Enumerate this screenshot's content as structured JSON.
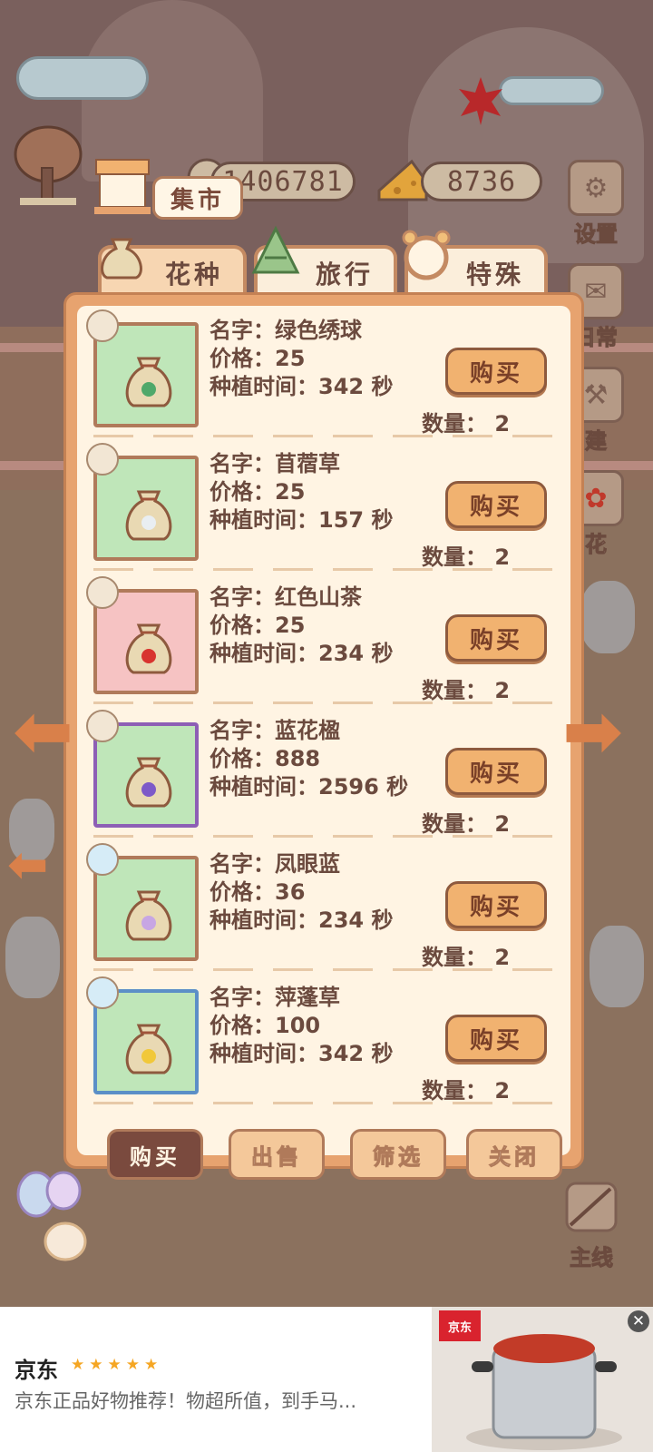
{
  "currency": {
    "coins": "1406781",
    "cheese": "8736"
  },
  "market_sign": "集市",
  "side_buttons": [
    {
      "label": "设置",
      "icon": "gear-icon"
    },
    {
      "label": "日常",
      "icon": "scroll-icon"
    },
    {
      "label": "建",
      "icon": "hammer-icon"
    },
    {
      "label": "花",
      "icon": "flower-icon"
    }
  ],
  "tabs": [
    {
      "label": "花种",
      "icon": "seed-bag-icon",
      "active": true
    },
    {
      "label": "旅行",
      "icon": "dumpling-icon",
      "active": false
    },
    {
      "label": "特殊",
      "icon": "frame-icon",
      "active": false
    }
  ],
  "item_labels": {
    "name": "名字：",
    "price": "价格：",
    "time": "种植时间：",
    "unit": "秒",
    "qty": "数量：",
    "buy": "购买"
  },
  "items": [
    {
      "name": "绿色绣球",
      "price": "25",
      "time": "342",
      "qty": "2",
      "bg": "#bfe6b9",
      "border": "#b07a5a",
      "flower": "#4fa86a",
      "season": "autumn"
    },
    {
      "name": "苜蓿草",
      "price": "25",
      "time": "157",
      "qty": "2",
      "bg": "#bfe6b9",
      "border": "#b07a5a",
      "flower": "#e9eef2",
      "season": "autumn"
    },
    {
      "name": "红色山茶",
      "price": "25",
      "time": "234",
      "qty": "2",
      "bg": "#f6c3c3",
      "border": "#b07a5a",
      "flower": "#d8342f",
      "season": "autumn"
    },
    {
      "name": "蓝花楹",
      "price": "888",
      "time": "2596",
      "qty": "2",
      "bg": "#bfe6b9",
      "border": "#8d5fb5",
      "flower": "#7d5ac8",
      "season": "autumn"
    },
    {
      "name": "凤眼蓝",
      "price": "36",
      "time": "234",
      "qty": "2",
      "bg": "#bfe6b9",
      "border": "#b07a5a",
      "flower": "#c7a6e3",
      "season": "winter"
    },
    {
      "name": "萍蓬草",
      "price": "100",
      "time": "342",
      "qty": "2",
      "bg": "#bfe6b9",
      "border": "#5b8fc7",
      "flower": "#f1c83a",
      "season": "winter"
    }
  ],
  "bottom_buttons": [
    {
      "label": "购买",
      "active": true
    },
    {
      "label": "出售",
      "active": false
    },
    {
      "label": "筛选",
      "active": false
    },
    {
      "label": "关闭",
      "active": false
    }
  ],
  "main_quest": "主线",
  "ad": {
    "title": "京东",
    "stars": "★★★★★",
    "desc": "京东正品好物推荐！物超所值，到手马...",
    "badge": "京东"
  }
}
